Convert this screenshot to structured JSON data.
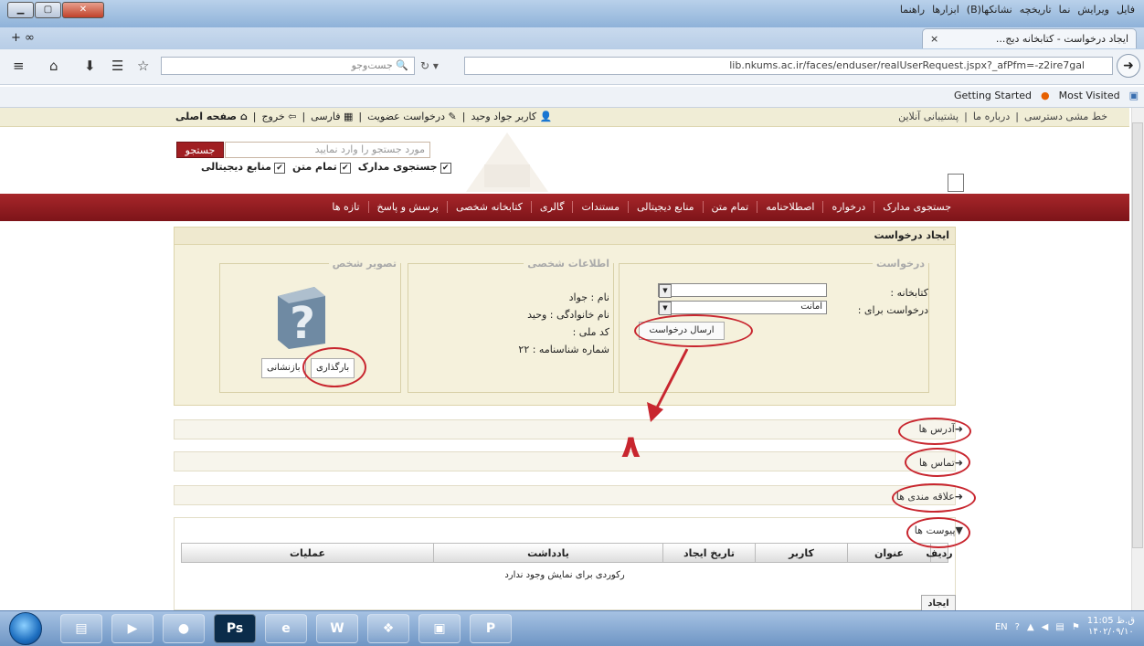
{
  "browser": {
    "menu_items": [
      "فایل",
      "ویرایش",
      "نما",
      "تاریخچه",
      "نشانکها(B)",
      "ابزارها",
      "راهنما"
    ],
    "tab_title": "ایجاد درخواست - کتابخانه دیج...",
    "tab_close": "×",
    "new_tab": "+ ∞",
    "search_placeholder": "جست‌وجو",
    "url": "lib.nkums.ac.ir/faces/enduser/realUserRequest.jspx?_afPfm=-z2ire7gal",
    "bookmarks": [
      "Getting Started",
      "Most Visited"
    ]
  },
  "site": {
    "user_links": [
      "کاربر جواد وحید",
      "درخواست عضویت",
      "فارسی",
      "خروج",
      "صفحه اصلی"
    ],
    "top_links": [
      "خط مشی دسترسی",
      "درباره ما",
      "پشتیبانی آنلاین"
    ],
    "search_placeholder": "مورد جستجو را وارد نمایید",
    "search_button": "جستجو",
    "checkboxes": [
      "جستجوی مدارک",
      "تمام متن",
      "منابع دیجیتالی"
    ],
    "nav": [
      "جستجوی مدارک",
      "درخواره",
      "اصطلاحنامه",
      "تمام متن",
      "منابع دیجیتالی",
      "مستندات",
      "گالری",
      "کتابخانه شخصی",
      "پرسش و پاسخ",
      "تازه ها"
    ]
  },
  "request": {
    "panel_title": "ایجاد درخواست",
    "fieldset_request": "درخواست",
    "library_label": "کتابخانه :",
    "request_for_label": "درخواست برای :",
    "request_for_value": "امانت",
    "send_button": "ارسال درخواست",
    "fieldset_personal": "اطلاعات شخصی",
    "name": "نام : جواد",
    "family": "نام خانوادگی : وحید",
    "national_code": "کد ملی :",
    "id_number": "شماره شناسنامه : ۲۲",
    "fieldset_photo": "تصویر شخص",
    "upload_button": "بارگذاری",
    "reset_button": "بازنشانی",
    "annotation_number": "۸"
  },
  "sections": [
    "آدرس ها",
    "تماس ها",
    "علاقه مندی ها",
    "پیوست ها"
  ],
  "attachments_table": {
    "headers": [
      "ردیف",
      "عنوان",
      "کاربر",
      "تاریخ ایجاد",
      "یادداشت",
      "عملیات"
    ],
    "empty_text": "رکوردی برای نمایش وجود ندارد",
    "create_button": "ایجاد"
  },
  "taskbar": {
    "apps": [
      "explorer",
      "media-player",
      "firefox",
      "photoshop",
      "internet-explorer",
      "word",
      "library-app",
      "image-viewer",
      "powerpoint"
    ],
    "lang": "EN",
    "time": "ق.ظ 11:05",
    "date": "۱۴۰۲/۰۹/۱۰"
  },
  "colors": {
    "nav_red": "#9a1d22",
    "annotation_red": "#c8262f",
    "panel_bg": "#f5f1dc"
  }
}
